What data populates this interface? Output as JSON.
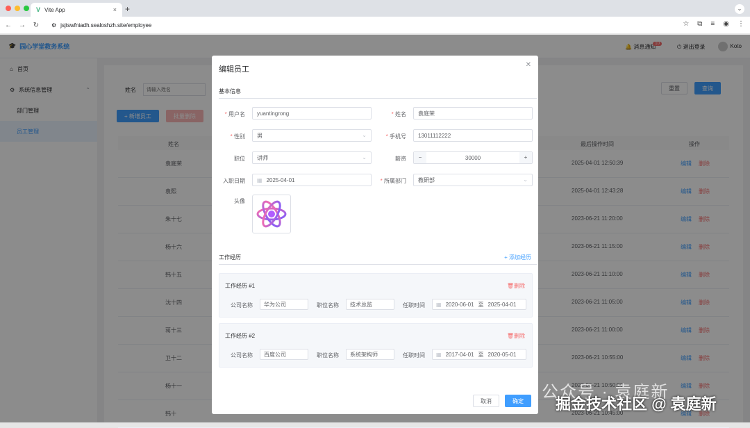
{
  "browser": {
    "tab_title": "Vite App",
    "url": "jsjtswfniadh.sealoshzh.site/employee"
  },
  "app": {
    "logo_text": "园心学堂教务系统",
    "header": {
      "notify_label": "消息通知",
      "notify_count": "10",
      "logout_label": "退出登录",
      "username": "Koto"
    },
    "sidebar": {
      "items": [
        {
          "label": "首页"
        },
        {
          "label": "系统信息管理"
        },
        {
          "label": "部门管理"
        },
        {
          "label": "员工管理"
        }
      ]
    },
    "search": {
      "name_label": "姓名",
      "name_placeholder": "请输入姓名",
      "reset_label": "重置",
      "query_label": "查询"
    },
    "toolbar": {
      "add_label": "+ 新增员工",
      "batch_delete_label": "批量删除"
    },
    "table": {
      "headers": {
        "name": "姓名",
        "last_op": "最后操作时间",
        "actions": "操作"
      },
      "edit_label": "编辑",
      "delete_label": "删除",
      "rows": [
        {
          "name": "袁庭荣",
          "time": "2025-04-01 12:50:39"
        },
        {
          "name": "袁熙",
          "time": "2025-04-01 12:43:28"
        },
        {
          "name": "朱十七",
          "time": "2023-06-21 11:20:00"
        },
        {
          "name": "杨十六",
          "time": "2023-06-21 11:15:00"
        },
        {
          "name": "韩十五",
          "time": "2023-06-21 11:10:00"
        },
        {
          "name": "沈十四",
          "time": "2023-06-21 11:05:00"
        },
        {
          "name": "蒋十三",
          "time": "2023-06-21 11:00:00"
        },
        {
          "name": "卫十二",
          "time": "2023-06-21 10:55:00"
        },
        {
          "name": "杨十一",
          "time": "2023-06-21 10:50:00"
        },
        {
          "name": "韩十",
          "time": "2023-06-21 10:45:00"
        }
      ]
    }
  },
  "dialog": {
    "title": "编辑员工",
    "basic_section": "基本信息",
    "fields": {
      "username_label": "用户名",
      "username_value": "yuantingrong",
      "name_label": "姓名",
      "name_value": "袁庭荣",
      "gender_label": "性别",
      "gender_value": "男",
      "phone_label": "手机号",
      "phone_value": "13011112222",
      "job_label": "职位",
      "job_value": "讲师",
      "salary_label": "薪资",
      "salary_value": "30000",
      "entry_label": "入职日期",
      "entry_value": "2025-04-01",
      "dept_label": "所属部门",
      "dept_value": "教研部",
      "avatar_label": "头像"
    },
    "work_section": "工作经历",
    "add_exp_label": "+ 添加经历",
    "exp_delete_label": "删除",
    "exp_company_label": "公司名称",
    "exp_job_label": "职位名称",
    "exp_period_label": "任职时间",
    "exp_to": "至",
    "experiences": [
      {
        "title": "工作经历 #1",
        "company": "华为公司",
        "job": "技术总监",
        "start": "2020-06-01",
        "end": "2025-04-01"
      },
      {
        "title": "工作经历 #2",
        "company": "百度公司",
        "job": "系统架构师",
        "start": "2017-04-01",
        "end": "2020-05-01"
      }
    ],
    "cancel_label": "取消",
    "confirm_label": "确定"
  },
  "watermark": {
    "line1": "公众号 · 袁庭新",
    "line2": "掘金技术社区 @ 袁庭新"
  },
  "colors": {
    "primary": "#409eff",
    "danger": "#f56c6c"
  }
}
